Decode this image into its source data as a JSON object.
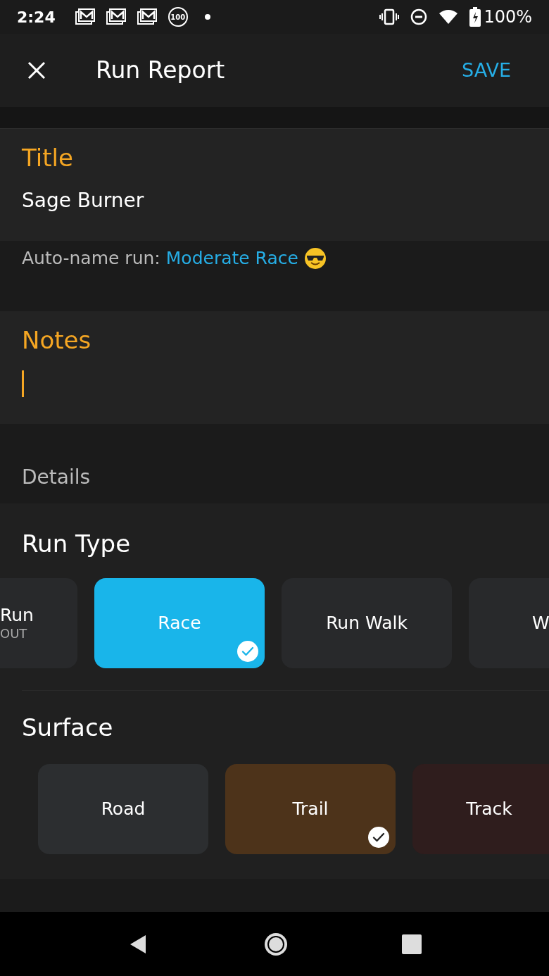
{
  "status_bar": {
    "time": "2:24",
    "notification_badge": "100",
    "battery": "100%"
  },
  "app_bar": {
    "title": "Run Report",
    "action": "SAVE"
  },
  "title_field": {
    "label": "Title",
    "value": "Sage Burner"
  },
  "auto_name": {
    "label": "Auto-name run:",
    "suggestion": "Moderate Race"
  },
  "notes_field": {
    "label": "Notes",
    "focused": true
  },
  "details": {
    "heading": "Details"
  },
  "run_type": {
    "heading": "Run Type",
    "options": [
      {
        "label": "Run",
        "sublabel": "OUT",
        "kind": "clipped_left",
        "selected": false
      },
      {
        "label": "Race",
        "kind": "full",
        "selected": true
      },
      {
        "label": "Run Walk",
        "kind": "full",
        "selected": false
      },
      {
        "label": "W",
        "kind": "clipped_right",
        "selected": false
      }
    ]
  },
  "surface": {
    "heading": "Surface",
    "options": [
      {
        "label": "Road",
        "color": "#2c2e30",
        "selected": false
      },
      {
        "label": "Trail",
        "color": "#4d331a",
        "selected": true
      },
      {
        "label": "Track",
        "color": "#2f1d1d",
        "selected": false
      }
    ]
  }
}
